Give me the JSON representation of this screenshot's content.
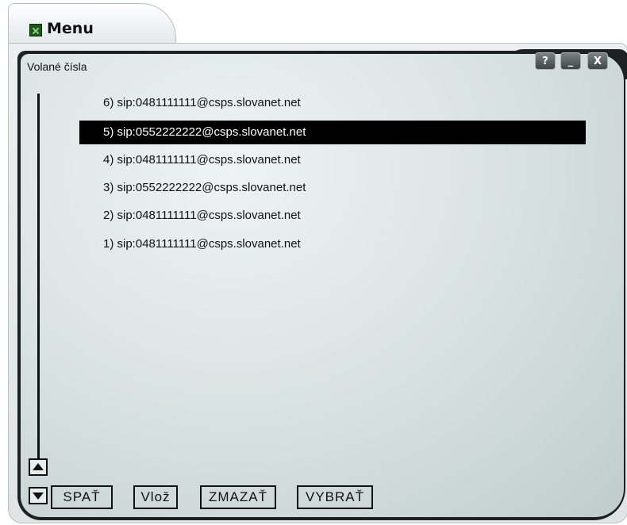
{
  "window": {
    "tab_title": "Menu"
  },
  "window_controls": {
    "help": "?",
    "minimize": "_",
    "close": "X"
  },
  "panel": {
    "title": "Volané čísla"
  },
  "list": {
    "items": [
      {
        "label": "6) sip:0481111111@csps.slovanet.net",
        "selected": false
      },
      {
        "label": "5) sip:0552222222@csps.slovanet.net",
        "selected": true
      },
      {
        "label": "4) sip:0481111111@csps.slovanet.net",
        "selected": false
      },
      {
        "label": "3) sip:0552222222@csps.slovanet.net",
        "selected": false
      },
      {
        "label": "2) sip:0481111111@csps.slovanet.net",
        "selected": false
      },
      {
        "label": "1) sip:0481111111@csps.slovanet.net",
        "selected": false
      }
    ]
  },
  "buttons": {
    "back": "SPAŤ",
    "insert": "Vlož",
    "delete": "ZMAZAŤ",
    "select": "VYBRAŤ"
  },
  "icons": {
    "app": "app-icon",
    "scroll_up": "arrow-up-icon",
    "scroll_down": "arrow-down-icon"
  }
}
